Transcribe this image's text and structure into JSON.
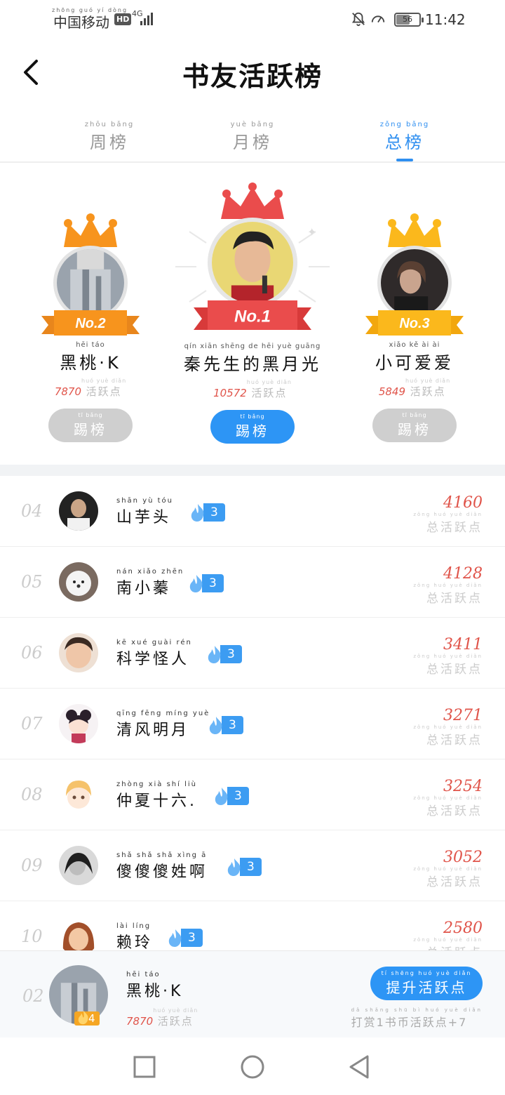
{
  "status_bar": {
    "carrier_pinyin": "zhōng guó yí dòng",
    "carrier": "中国移动",
    "hd": "HD",
    "network": "4G",
    "battery": "56",
    "time": "11:42"
  },
  "header": {
    "title": "书友活跃榜",
    "back_icon": "chevron-left-icon"
  },
  "tabs": [
    {
      "pinyin": "zhōu bǎng",
      "label": "周榜",
      "active": false
    },
    {
      "pinyin": "yuè bǎng",
      "label": "月榜",
      "active": false
    },
    {
      "pinyin": "zǒng bǎng",
      "label": "总榜",
      "active": true
    }
  ],
  "podium": {
    "first": {
      "rank": "No.1",
      "name_pinyin": "qín xiān shēng de hēi yuè guāng",
      "name": "秦先生的黑月光",
      "score": "10572",
      "unit_pinyin": "huó yuè diǎn",
      "unit": "活跃点",
      "btn_pinyin": "tī bǎng",
      "btn": "踢榜"
    },
    "second": {
      "rank": "No.2",
      "name_pinyin": "hēi táo",
      "name": "黑桃·K",
      "score": "7870",
      "unit_pinyin": "huó yuè diǎn",
      "unit": "活跃点",
      "btn_pinyin": "tī bǎng",
      "btn": "踢榜"
    },
    "third": {
      "rank": "No.3",
      "name_pinyin": "xiǎo kě ài ài",
      "name": "小可爱爱",
      "score": "5849",
      "unit_pinyin": "huó yuè diǎn",
      "unit": "活跃点",
      "btn_pinyin": "tī bǎng",
      "btn": "踢榜"
    }
  },
  "list": [
    {
      "rank": "04",
      "name_pinyin": "shān yù tóu",
      "name": "山芋头",
      "level": "3",
      "score": "4160",
      "unit_pinyin": "zǒng huó yuè diǎn",
      "unit": "总活跃点"
    },
    {
      "rank": "05",
      "name_pinyin": "nán xiǎo zhēn",
      "name": "南小蓁",
      "level": "3",
      "score": "4128",
      "unit_pinyin": "zǒng huó yuè diǎn",
      "unit": "总活跃点"
    },
    {
      "rank": "06",
      "name_pinyin": "kē xué guài rén",
      "name": "科学怪人",
      "level": "3",
      "score": "3411",
      "unit_pinyin": "zǒng huó yuè diǎn",
      "unit": "总活跃点"
    },
    {
      "rank": "07",
      "name_pinyin": "qīng fēng míng yuè",
      "name": "清风明月",
      "level": "3",
      "score": "3271",
      "unit_pinyin": "zǒng huó yuè diǎn",
      "unit": "总活跃点"
    },
    {
      "rank": "08",
      "name_pinyin": "zhòng xià shí liù",
      "name": "仲夏十六.",
      "level": "3",
      "score": "3254",
      "unit_pinyin": "zǒng huó yuè diǎn",
      "unit": "总活跃点"
    },
    {
      "rank": "09",
      "name_pinyin": "shǎ shǎ shǎ xìng ā",
      "name": "傻傻傻姓啊",
      "level": "3",
      "score": "3052",
      "unit_pinyin": "zǒng huó yuè diǎn",
      "unit": "总活跃点"
    },
    {
      "rank": "10",
      "name_pinyin": "lài líng",
      "name": "赖玲",
      "level": "3",
      "score": "2580",
      "unit_pinyin": "zǒng huó yuè diǎn",
      "unit": "总活跃点"
    }
  ],
  "my_rank": {
    "rank": "02",
    "name_pinyin": "hēi táo",
    "name": "黑桃·K",
    "level": "4",
    "score": "7870",
    "unit_pinyin": "huó yuè diǎn",
    "unit": "活跃点",
    "boost_pinyin": "tí shēng huó yuè diǎn",
    "boost": "提升活跃点",
    "hint_pinyin": "dǎ shǎng shū bì huó yuè diǎn",
    "hint": "打赏1书币活跃点+7"
  },
  "colors": {
    "accent": "#2d95f5",
    "score": "#e0544a",
    "gold": "#f5a623",
    "crown_red": "#e94b4b"
  }
}
